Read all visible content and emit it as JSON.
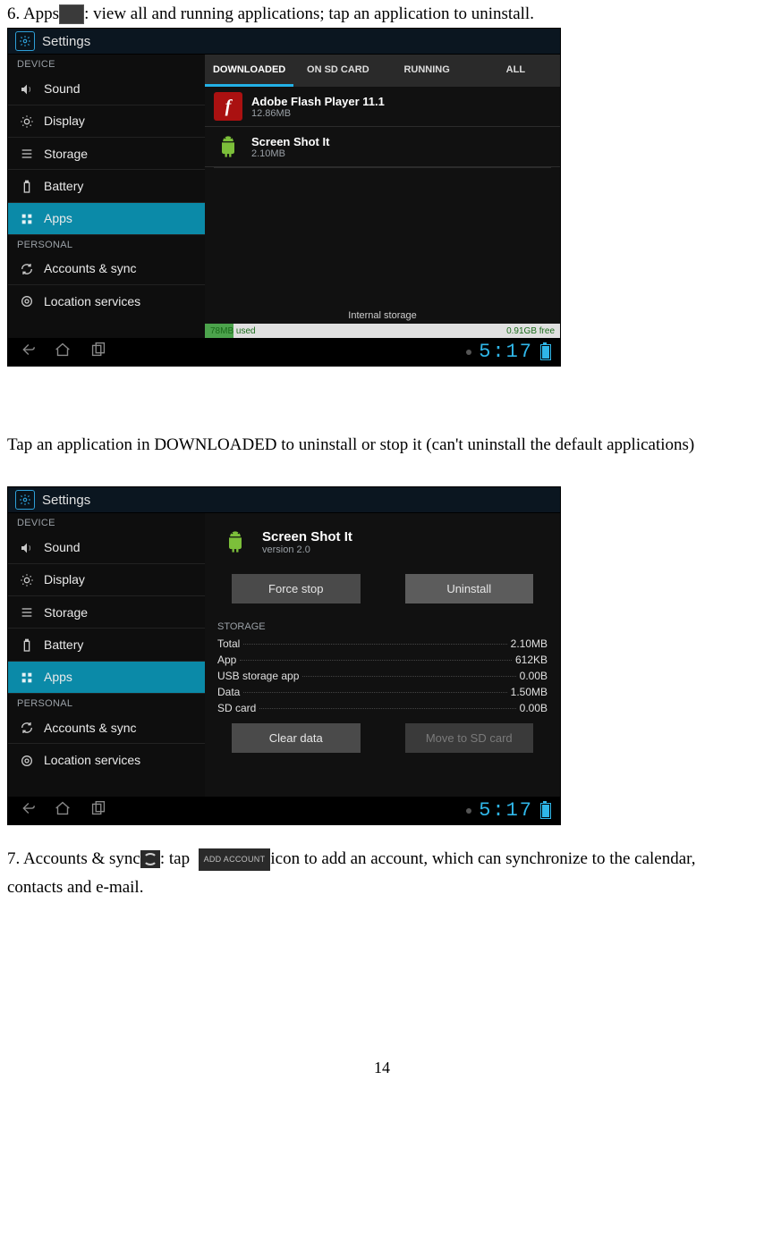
{
  "body": {
    "line1_part1": "6. Apps",
    "line1_part2": ": view all and running applications; tap an application to uninstall.",
    "mid_para": "Tap an application in DOWNLOADED to uninstall or stop it (can't uninstall the default applications)",
    "line7_p1": "7. Accounts & sync",
    "line7_p2": ": tap ",
    "line7_addacct": "ADD ACCOUNT",
    "line7_p3": "icon to add an account, which can synchronize to the calendar,",
    "line7_p4": "contacts and e-mail.",
    "page_number": "14"
  },
  "common": {
    "title": "Settings",
    "section_device": "DEVICE",
    "section_personal": "PERSONAL",
    "sidebar": {
      "sound": "Sound",
      "display": "Display",
      "storage": "Storage",
      "battery": "Battery",
      "apps": "Apps",
      "accounts": "Accounts & sync",
      "location": "Location services"
    },
    "time": "5:17"
  },
  "shot1": {
    "tabs": {
      "downloaded": "DOWNLOADED",
      "onsd": "ON SD CARD",
      "running": "RUNNING",
      "all": "ALL"
    },
    "apps": [
      {
        "name": "Adobe Flash Player 11.1",
        "size": "12.86MB"
      },
      {
        "name": "Screen Shot It",
        "size": "2.10MB"
      }
    ],
    "storage_label": "Internal storage",
    "used": "78MB used",
    "free": "0.91GB free"
  },
  "shot2": {
    "app": {
      "name": "Screen Shot It",
      "ver": "version 2.0"
    },
    "btn_forcestop": "Force stop",
    "btn_uninstall": "Uninstall",
    "storage_header": "STORAGE",
    "rows": {
      "total_k": "Total",
      "total_v": "2.10MB",
      "app_k": "App",
      "app_v": "612KB",
      "usb_k": "USB storage app",
      "usb_v": "0.00B",
      "data_k": "Data",
      "data_v": "1.50MB",
      "sd_k": "SD card",
      "sd_v": "0.00B"
    },
    "btn_clear": "Clear data",
    "btn_move": "Move to SD card"
  }
}
